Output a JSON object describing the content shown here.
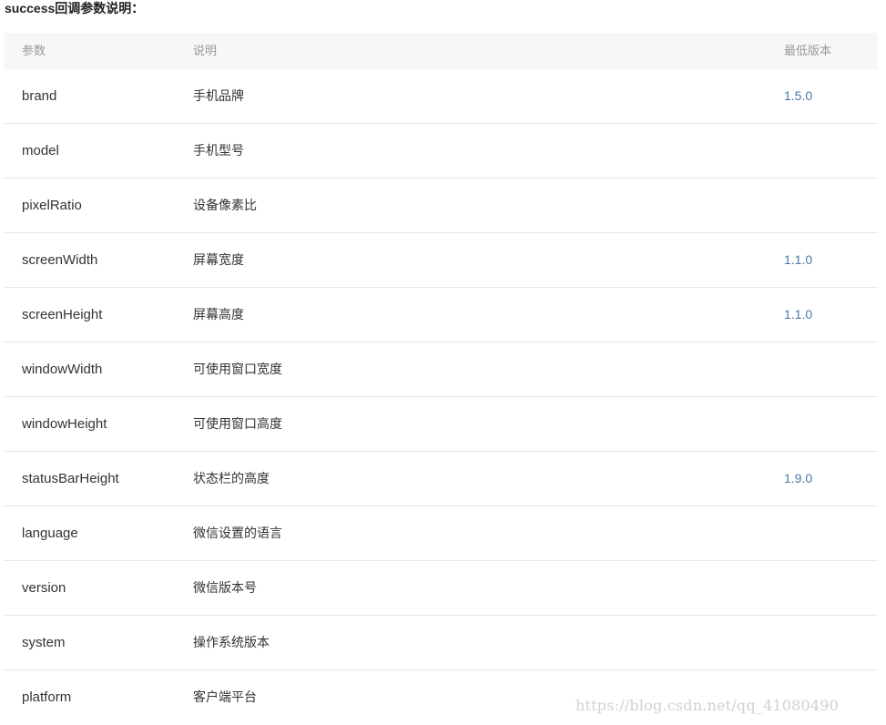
{
  "section_title": "success回调参数说明：",
  "table": {
    "headers": {
      "param": "参数",
      "desc": "说明",
      "version": "最低版本"
    },
    "rows": [
      {
        "param": "brand",
        "desc": "手机品牌",
        "version": "1.5.0"
      },
      {
        "param": "model",
        "desc": "手机型号",
        "version": ""
      },
      {
        "param": "pixelRatio",
        "desc": "设备像素比",
        "version": ""
      },
      {
        "param": "screenWidth",
        "desc": "屏幕宽度",
        "version": "1.1.0"
      },
      {
        "param": "screenHeight",
        "desc": "屏幕高度",
        "version": "1.1.0"
      },
      {
        "param": "windowWidth",
        "desc": "可使用窗口宽度",
        "version": ""
      },
      {
        "param": "windowHeight",
        "desc": "可使用窗口高度",
        "version": ""
      },
      {
        "param": "statusBarHeight",
        "desc": "状态栏的高度",
        "version": "1.9.0"
      },
      {
        "param": "language",
        "desc": "微信设置的语言",
        "version": ""
      },
      {
        "param": "version",
        "desc": "微信版本号",
        "version": ""
      },
      {
        "param": "system",
        "desc": "操作系统版本",
        "version": ""
      },
      {
        "param": "platform",
        "desc": "客户端平台",
        "version": ""
      }
    ]
  },
  "watermark": "https://blog.csdn.net/qq_41080490",
  "colors": {
    "header_bg": "#f7f7f7",
    "version_link": "#4a76a8",
    "border": "#e8e8e8"
  }
}
